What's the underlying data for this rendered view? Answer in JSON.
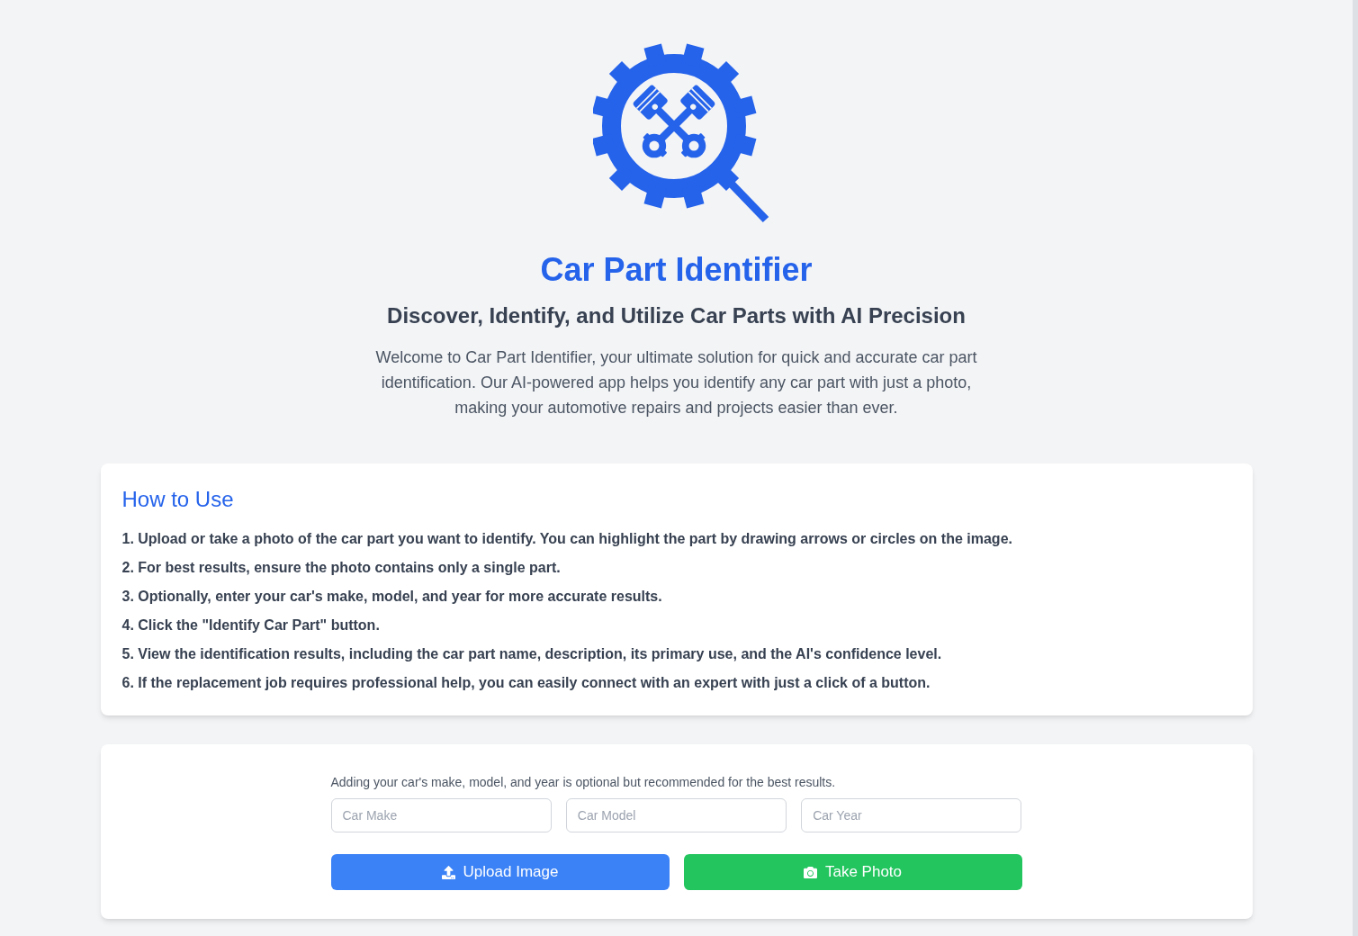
{
  "header": {
    "title": "Car Part Identifier",
    "subtitle": "Discover, Identify, and Utilize Car Parts with AI Precision",
    "intro": "Welcome to Car Part Identifier, your ultimate solution for quick and accurate car part identification. Our AI-powered app helps you identify any car part with just a photo, making your automotive repairs and projects easier than ever."
  },
  "how_to_use": {
    "title": "How to Use",
    "steps": [
      "1. Upload or take a photo of the car part you want to identify. You can highlight the part by drawing arrows or circles on the image.",
      "2. For best results, ensure the photo contains only a single part.",
      "3. Optionally, enter your car's make, model, and year for more accurate results.",
      "4. Click the \"Identify Car Part\" button.",
      "5. View the identification results, including the car part name, description, its primary use, and the AI's confidence level.",
      "6. If the replacement job requires professional help, you can easily connect with an expert with just a click of a button."
    ]
  },
  "form": {
    "note": "Adding your car's make, model, and year is optional but recommended for the best results.",
    "fields": [
      {
        "placeholder": "Car Make"
      },
      {
        "placeholder": "Car Model"
      },
      {
        "placeholder": "Car Year"
      }
    ],
    "buttons": [
      {
        "label": "Upload Image",
        "kind": "upload"
      },
      {
        "label": "Take Photo",
        "kind": "camera"
      }
    ]
  }
}
